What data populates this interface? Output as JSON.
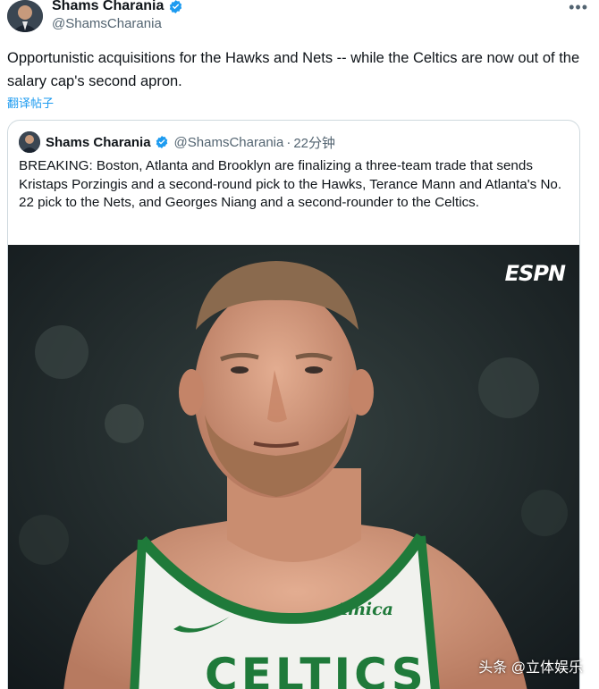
{
  "tweet": {
    "author_name": "Shams Charania",
    "author_handle": "@ShamsCharania",
    "more_icon": "more-horizontal-icon",
    "text": "Opportunistic acquisitions for the Hawks and Nets -- while the Celtics are now out of the salary cap's second apron.",
    "translate_label": "翻译帖子"
  },
  "quote": {
    "author_name": "Shams Charania",
    "author_handle": "@ShamsCharania",
    "separator": "·",
    "time": "22分钟",
    "text": "BREAKING: Boston, Atlanta and Brooklyn are finalizing a three-team trade that sends Kristaps Porzingis and a second-round pick to the Hawks, Terance Mann and Atlanta's No. 22 pick to the Nets, and Georges Niang and a second-rounder to the Celtics."
  },
  "photo": {
    "brand": "ESPN",
    "jersey_sponsor": "Amica",
    "jersey_text": "CELTICS"
  },
  "watermark": "头条 @立体娱乐",
  "colors": {
    "verified": "#1d9bf0",
    "link": "#1d9bf0",
    "jersey_green": "#1f7a3a"
  }
}
